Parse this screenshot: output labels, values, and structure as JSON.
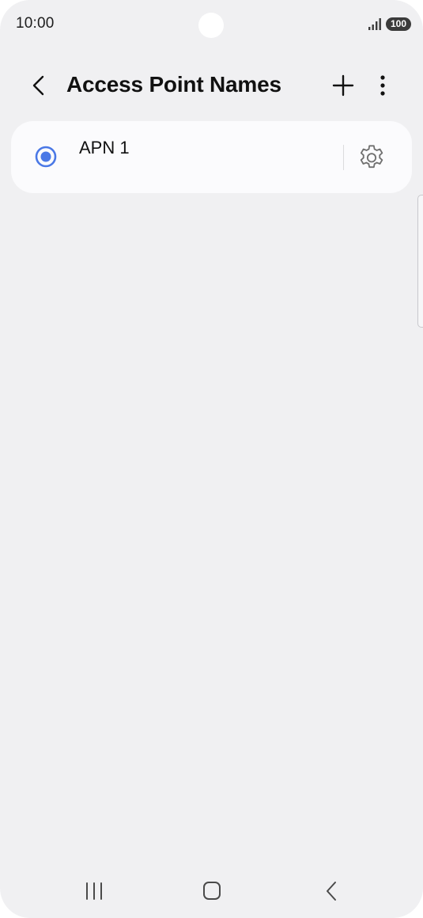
{
  "status_bar": {
    "time": "10:00",
    "battery_level": "100",
    "icons": [
      "signal-icon",
      "battery-icon"
    ]
  },
  "header": {
    "title": "Access Point Names",
    "icons": [
      "back-arrow-icon",
      "plus-icon",
      "more-vertical-icon"
    ]
  },
  "apn_list": [
    {
      "name": "APN 1",
      "selected": true,
      "icons": [
        "radio-selected-icon",
        "gear-icon"
      ]
    }
  ],
  "nav_bar": {
    "icons": [
      "recents-icon",
      "home-icon",
      "back-icon"
    ]
  },
  "colors": {
    "background": "#f0f0f2",
    "card": "#fbfbfd",
    "accent": "#4a78e6",
    "text": "#111111"
  }
}
